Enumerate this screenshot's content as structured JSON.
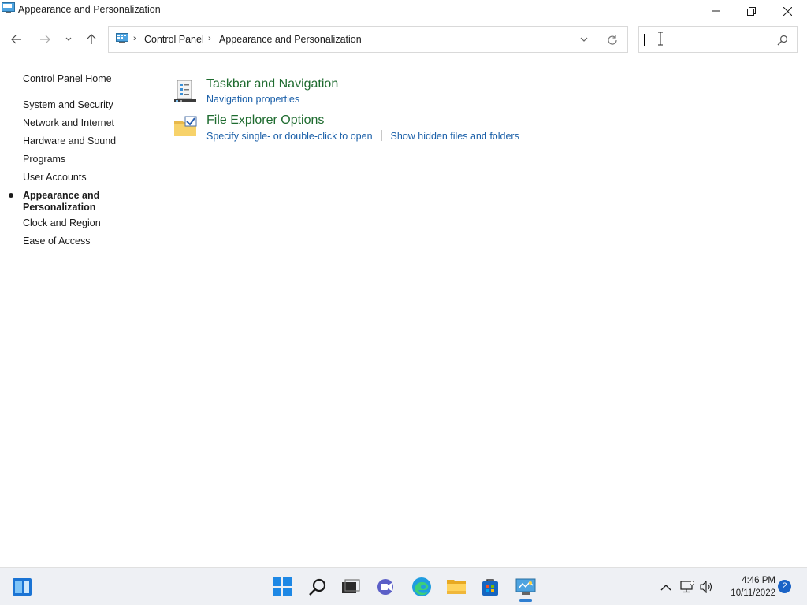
{
  "window": {
    "title": "Appearance and Personalization"
  },
  "address": {
    "crumbs": [
      "Control Panel",
      "Appearance and Personalization"
    ]
  },
  "search": {
    "placeholder": "",
    "value": ""
  },
  "sidebar": {
    "home": "Control Panel Home",
    "items": [
      {
        "label": "System and Security"
      },
      {
        "label": "Network and Internet"
      },
      {
        "label": "Hardware and Sound"
      },
      {
        "label": "Programs"
      },
      {
        "label": "User Accounts"
      },
      {
        "label": "Appearance and Personalization",
        "line1": "Appearance and",
        "line2": "Personalization",
        "active": true
      },
      {
        "label": "Clock and Region"
      },
      {
        "label": "Ease of Access"
      }
    ]
  },
  "main": {
    "categories": [
      {
        "title": "Taskbar and Navigation",
        "icon": "taskbar-icon",
        "links": [
          "Navigation properties"
        ]
      },
      {
        "title": "File Explorer Options",
        "icon": "folder-options-icon",
        "links": [
          "Specify single- or double-click to open",
          "Show hidden files and folders"
        ]
      }
    ]
  },
  "taskbar": {
    "apps": [
      "widgets-icon",
      "start-icon",
      "search-icon",
      "task-view-icon",
      "chat-icon",
      "edge-icon",
      "file-explorer-icon",
      "store-icon",
      "control-panel-icon"
    ],
    "clock_time": "4:46 PM",
    "clock_date": "10/11/2022",
    "notification_count": "2"
  },
  "colors": {
    "link": "#1a5fa8",
    "category_title": "#1e6b2f",
    "accent": "#2f7fd1"
  }
}
